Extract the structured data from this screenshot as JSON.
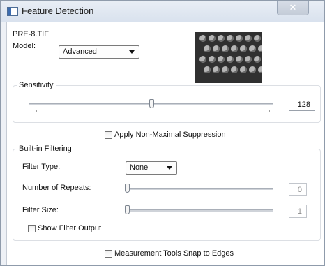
{
  "window": {
    "title": "Feature Detection",
    "close_glyph": "✕"
  },
  "file_name": "PRE-8.TIF",
  "model": {
    "label": "Model:",
    "value": "Advanced"
  },
  "sensitivity": {
    "title": "Sensitivity",
    "value": "128",
    "level": 0.5
  },
  "nms": {
    "label": "Apply Non-Maximal Suppression",
    "checked": false
  },
  "filtering": {
    "title": "Built-in Filtering",
    "filter_type": {
      "label": "Filter Type:",
      "value": "None"
    },
    "repeats": {
      "label": "Number of Repeats:",
      "value": "0",
      "level": 0
    },
    "filter_size": {
      "label": "Filter Size:",
      "value": "1",
      "level": 0
    },
    "show_output": {
      "label": "Show Filter Output",
      "checked": false
    }
  },
  "snap": {
    "label": "Measurement Tools Snap to Edges",
    "checked": false
  },
  "icons": [
    "window-icon",
    "close-icon",
    "dropdown-arrow-icon"
  ]
}
